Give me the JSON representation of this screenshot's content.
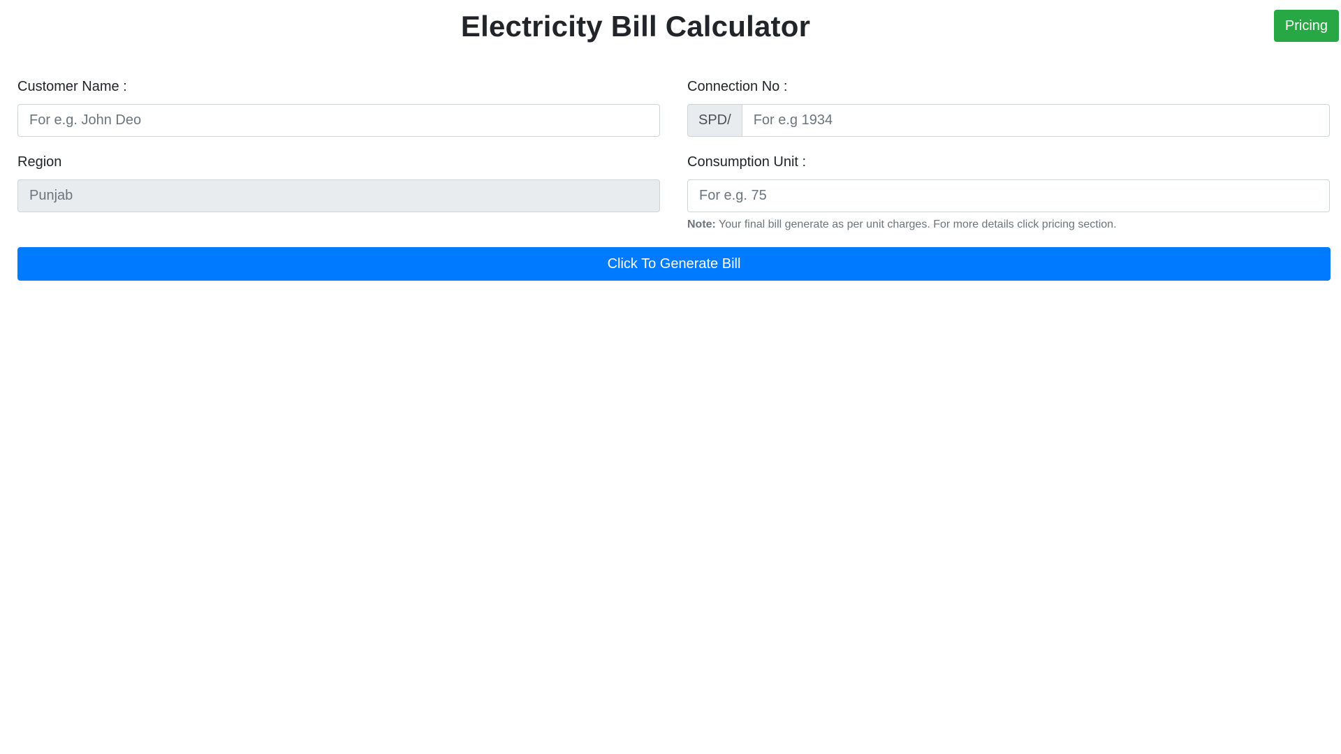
{
  "header": {
    "title": "Electricity Bill Calculator",
    "pricing_label": "Pricing"
  },
  "form": {
    "customer_name": {
      "label": "Customer Name :",
      "placeholder": "For e.g. John Deo",
      "value": ""
    },
    "connection_no": {
      "label": "Connection No :",
      "prefix": "SPD/",
      "placeholder": "For e.g 1934",
      "value": ""
    },
    "region": {
      "label": "Region",
      "value": "Punjab",
      "readonly": true
    },
    "consumption_unit": {
      "label": "Consumption Unit :",
      "placeholder": "For e.g. 75",
      "value": "",
      "note_bold": "Note:",
      "note_text": " Your final bill generate as per unit charges. For more details click pricing section."
    },
    "submit_label": "Click To Generate Bill"
  },
  "colors": {
    "primary": "#007bff",
    "success": "#28a745",
    "readonly_bg": "#e9ecef"
  }
}
